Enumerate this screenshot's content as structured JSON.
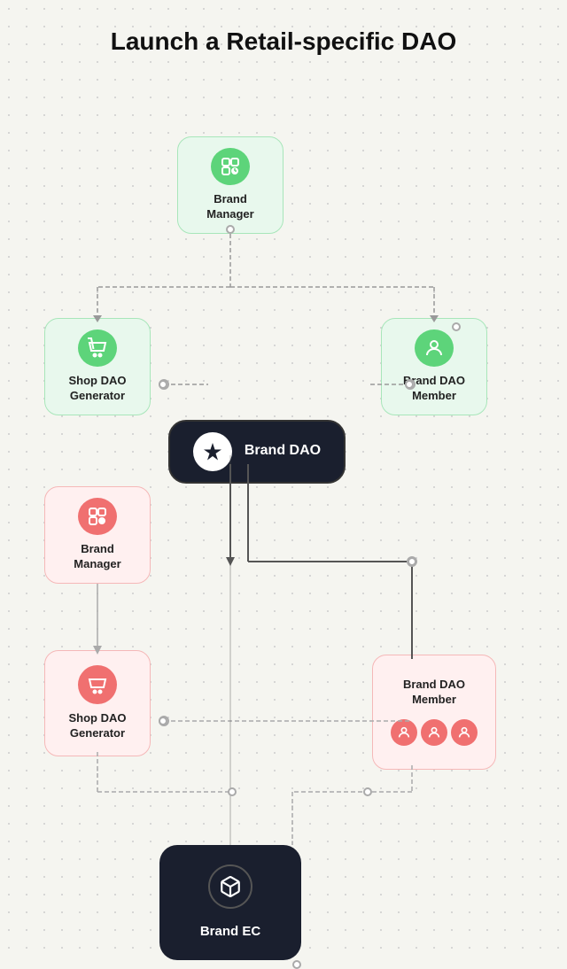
{
  "page": {
    "title": "Launch a Retail-specific DAO"
  },
  "nodes": {
    "brand_manager_top": {
      "label": "Brand\nManager",
      "icon": "👤"
    },
    "shop_dao_generator_green": {
      "label": "Shop DAO\nGenerator",
      "icon": "🏪"
    },
    "brand_dao_member_green": {
      "label": "Brand DAO\nMember",
      "icon": "👤"
    },
    "brand_dao": {
      "label": "Brand DAO",
      "icon": "🏆"
    },
    "brand_manager_red": {
      "label": "Brand\nManager",
      "icon": "👤"
    },
    "shop_dao_generator_red": {
      "label": "Shop DAO\nGenerator",
      "icon": "🏪"
    },
    "brand_dao_member_red": {
      "label": "Brand DAO\nMember",
      "icon": "👤"
    },
    "brand_ec": {
      "label": "Brand EC",
      "icon": "📦"
    }
  }
}
